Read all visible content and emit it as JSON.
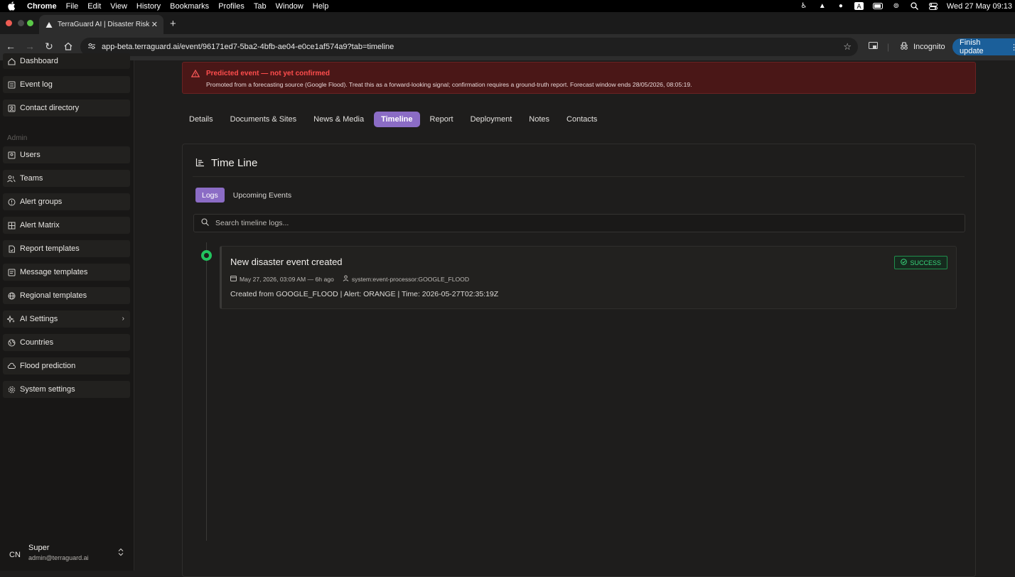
{
  "menubar": {
    "app": "Chrome",
    "items": [
      "File",
      "Edit",
      "View",
      "History",
      "Bookmarks",
      "Profiles",
      "Tab",
      "Window",
      "Help"
    ],
    "clock": "Wed 27 May  09:13"
  },
  "browser": {
    "tab_title": "TerraGuard AI | Disaster Risk",
    "url": "app-beta.terraguard.ai/event/96171ed7-5ba2-4bfb-ae04-e0ce1af574a9?tab=timeline",
    "incognito_label": "Incognito",
    "update_label": "Finish update"
  },
  "sidebar": {
    "top_items": [
      {
        "label": "Dashboard",
        "icon": "home-icon"
      },
      {
        "label": "Event log",
        "icon": "log-icon"
      },
      {
        "label": "Contact directory",
        "icon": "contacts-icon"
      }
    ],
    "admin_label": "Admin",
    "admin_items": [
      {
        "label": "Users",
        "icon": "user-icon"
      },
      {
        "label": "Teams",
        "icon": "team-icon"
      },
      {
        "label": "Alert groups",
        "icon": "alert-icon"
      },
      {
        "label": "Alert Matrix",
        "icon": "grid-icon"
      },
      {
        "label": "Report templates",
        "icon": "report-icon"
      },
      {
        "label": "Message templates",
        "icon": "message-icon"
      },
      {
        "label": "Regional templates",
        "icon": "globe-icon"
      },
      {
        "label": "AI Settings",
        "icon": "sparkle-icon"
      },
      {
        "label": "Countries",
        "icon": "globe-icon"
      },
      {
        "label": "Flood prediction",
        "icon": "cloud-icon"
      },
      {
        "label": "System settings",
        "icon": "gear-icon"
      }
    ],
    "user": {
      "initials": "CN",
      "name": "Super",
      "email": "admin@terraguard.ai"
    }
  },
  "alert": {
    "title": "Predicted event — not yet confirmed",
    "text": "Promoted from a forecasting source (Google Flood). Treat this as a forward-looking signal; confirmation requires a ground-truth report. Forecast window ends 28/05/2026, 08:05:19."
  },
  "tabs": [
    "Details",
    "Documents & Sites",
    "News & Media",
    "Timeline",
    "Report",
    "Deployment",
    "Notes",
    "Contacts"
  ],
  "active_tab": "Timeline",
  "timeline": {
    "title": "Time Line",
    "subtabs": [
      "Logs",
      "Upcoming Events"
    ],
    "search_placeholder": "Search timeline logs...",
    "log": {
      "title": "New disaster event created",
      "date": "May 27, 2026, 03:09 AM — 6h ago",
      "actor": "system:event-processor:GOOGLE_FLOOD",
      "body": "Created from GOOGLE_FLOOD | Alert: ORANGE | Time: 2026-05-27T02:35:19Z",
      "status": "SUCCESS"
    }
  },
  "colors": {
    "accent": "#8b6cc5",
    "success": "#22c55e",
    "danger": "#ff4d4d",
    "update": "#1b5f9a"
  }
}
